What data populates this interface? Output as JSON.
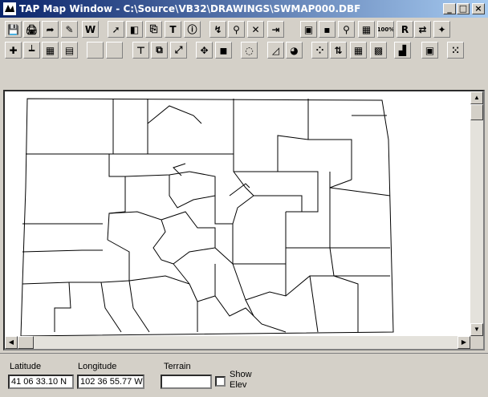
{
  "window": {
    "title": "TAP Map Window - C:\\Source\\VB32\\DRAWINGS\\SWMAP000.DBF",
    "minimize": "_",
    "maximize": "□",
    "close": "×"
  },
  "toolbar1": [
    {
      "name": "save-icon",
      "glyph": "💾"
    },
    {
      "name": "print-icon",
      "glyph": "🖨"
    },
    {
      "name": "export-icon",
      "glyph": "➦"
    },
    {
      "name": "edit-icon",
      "glyph": "✎"
    },
    {
      "name": "word-icon",
      "glyph": "W"
    },
    {
      "name": "pointer-icon",
      "glyph": "➚"
    },
    {
      "name": "layer-icon",
      "glyph": "◧"
    },
    {
      "name": "copy-icon",
      "glyph": "⎘"
    },
    {
      "name": "text-icon",
      "glyph": "T"
    },
    {
      "name": "info-icon",
      "glyph": "ⓘ"
    },
    {
      "name": "route-icon",
      "glyph": "↯"
    },
    {
      "name": "pick-icon",
      "glyph": "⚲"
    },
    {
      "name": "delete-icon",
      "glyph": "✕"
    },
    {
      "name": "exit-icon",
      "glyph": "⇥"
    },
    {
      "name": "green-node-icon",
      "glyph": "▣"
    },
    {
      "name": "green-dot-icon",
      "glyph": "▪"
    },
    {
      "name": "pin-icon",
      "glyph": "⚲"
    },
    {
      "name": "red-grid-icon",
      "glyph": "▦"
    },
    {
      "name": "percent-icon",
      "glyph": "100%"
    },
    {
      "name": "yellow-r-icon",
      "glyph": "R"
    },
    {
      "name": "link-icon",
      "glyph": "⇄"
    },
    {
      "name": "scatter-icon",
      "glyph": "✦"
    }
  ],
  "toolbar2": [
    {
      "name": "add-icon",
      "glyph": "✚"
    },
    {
      "name": "ruler-icon",
      "glyph": "┷"
    },
    {
      "name": "grid-icon",
      "glyph": "▦"
    },
    {
      "name": "notes-icon",
      "glyph": "▤"
    },
    {
      "name": "blank-icon",
      "glyph": ""
    },
    {
      "name": "blank-icon",
      "glyph": ""
    },
    {
      "name": "crop-icon",
      "glyph": "⊤"
    },
    {
      "name": "zoom-box-icon",
      "glyph": "⧉"
    },
    {
      "name": "resize-icon",
      "glyph": "⤢"
    },
    {
      "name": "pan-icon",
      "glyph": "✥"
    },
    {
      "name": "color-layers-icon",
      "glyph": "◼"
    },
    {
      "name": "polygon-icon",
      "glyph": "◌"
    },
    {
      "name": "profile-icon",
      "glyph": "◿"
    },
    {
      "name": "pie-icon",
      "glyph": "◕"
    },
    {
      "name": "points-icon",
      "glyph": "⁘"
    },
    {
      "name": "arrows-icon",
      "glyph": "⇅"
    },
    {
      "name": "mesh-icon",
      "glyph": "▦"
    },
    {
      "name": "color-grid-icon",
      "glyph": "▩"
    },
    {
      "name": "histogram-icon",
      "glyph": "▟"
    },
    {
      "name": "cells-icon",
      "glyph": "▣"
    },
    {
      "name": "dots-grid-icon",
      "glyph": "⁙"
    }
  ],
  "status": {
    "latitude_label": "Latitude",
    "latitude_value": "41 06 33.10 N",
    "longitude_label": "Longitude",
    "longitude_value": "102 36 55.77 W",
    "terrain_label": "Terrain",
    "terrain_value": "",
    "show_elev_line1": "Show",
    "show_elev_line2": "Elev"
  },
  "scroll": {
    "up": "▲",
    "down": "▼",
    "left": "◀",
    "right": "▶"
  }
}
